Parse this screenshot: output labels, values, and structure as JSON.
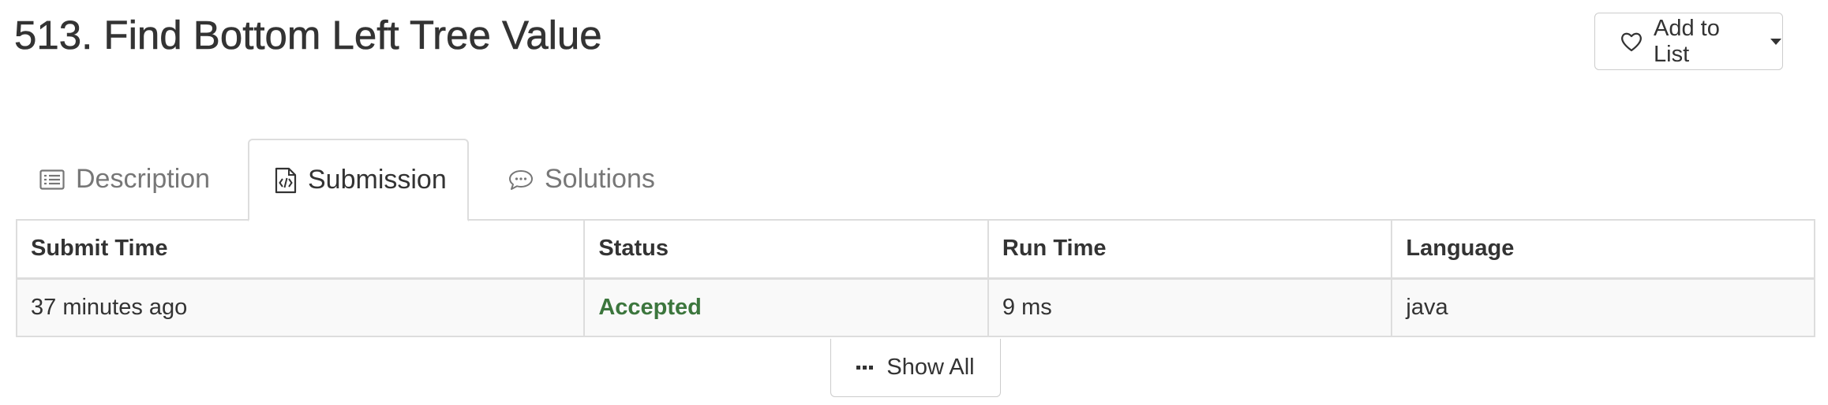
{
  "problem": {
    "title": "513. Find Bottom Left Tree Value"
  },
  "actions": {
    "add_to_list_label": "Add to List",
    "add_to_list_icon": "heart-icon",
    "dropdown_icon": "caret-down-icon"
  },
  "tabs": [
    {
      "label": "Description",
      "icon": "list-icon",
      "active": false
    },
    {
      "label": "Submission",
      "icon": "code-file-icon",
      "active": true
    },
    {
      "label": "Solutions",
      "icon": "comment-icon",
      "active": false
    }
  ],
  "submissions": {
    "headers": [
      "Submit Time",
      "Status",
      "Run Time",
      "Language"
    ],
    "rows": [
      {
        "submit_time": "37 minutes ago",
        "status": "Accepted",
        "run_time": "9 ms",
        "language": "java"
      }
    ],
    "status_color": "#3c763d",
    "show_all_label": "Show All",
    "show_all_icon": "ellipsis-icon"
  }
}
